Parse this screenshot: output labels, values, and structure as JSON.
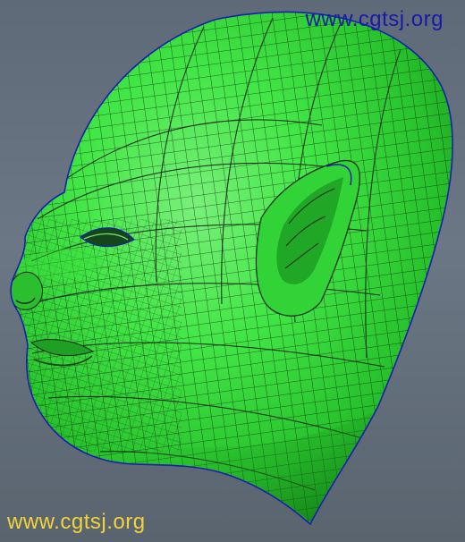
{
  "viewport": {
    "subject": "green wireframe head model",
    "background_color": "#62707d",
    "mesh_fill_color": "#35e23a",
    "mesh_shadow_color": "#1e9f22",
    "mesh_line_color": "#102610",
    "edge_color": "#1a1fae"
  },
  "watermarks": {
    "top": "www.cgtsj.org",
    "bottom": "www.cgtsj.org",
    "top_color": "#1a1aa8",
    "bottom_color": "#f2d43a"
  }
}
